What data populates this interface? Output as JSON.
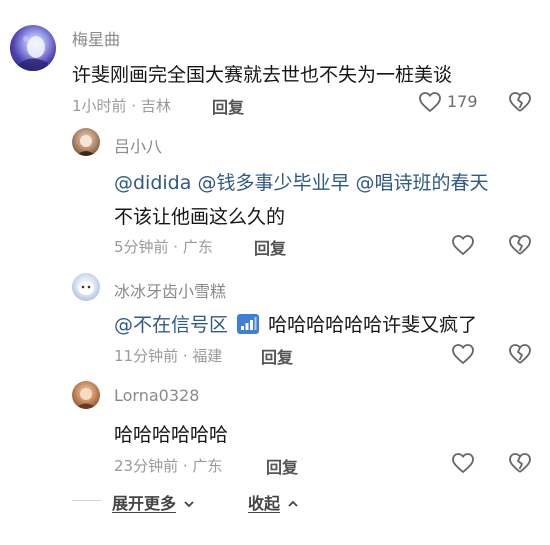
{
  "comment": {
    "author": "梅星曲",
    "text": "许斐刚画完全国大赛就去世也不失为一桩美谈",
    "meta": "1小时前 · 吉林",
    "reply_label": "回复",
    "like_count": "179"
  },
  "replies": [
    {
      "author": "吕小八",
      "mentions": [
        "@didida",
        "@钱多事少毕业早",
        "@唱诗班的春天"
      ],
      "text": "不该让他画这么久的",
      "meta": "5分钟前 · 广东",
      "reply_label": "回复"
    },
    {
      "author": "冰冰牙齿小雪糕",
      "mention": "@不在信号区",
      "text": "哈哈哈哈哈哈许斐又疯了",
      "meta": "11分钟前 · 福建",
      "reply_label": "回复"
    },
    {
      "author": "Lorna0328",
      "text": "哈哈哈哈哈哈",
      "meta": "23分钟前 · 广东",
      "reply_label": "回复"
    }
  ],
  "footer": {
    "expand_label": "展开更多",
    "collapse_label": "收起"
  },
  "icons": {
    "like": "heart-outline-icon",
    "dislike": "broken-heart-icon",
    "chevron_down": "chevron-down-icon",
    "chevron_up": "chevron-up-icon",
    "signal": "signal-bars-icon"
  }
}
